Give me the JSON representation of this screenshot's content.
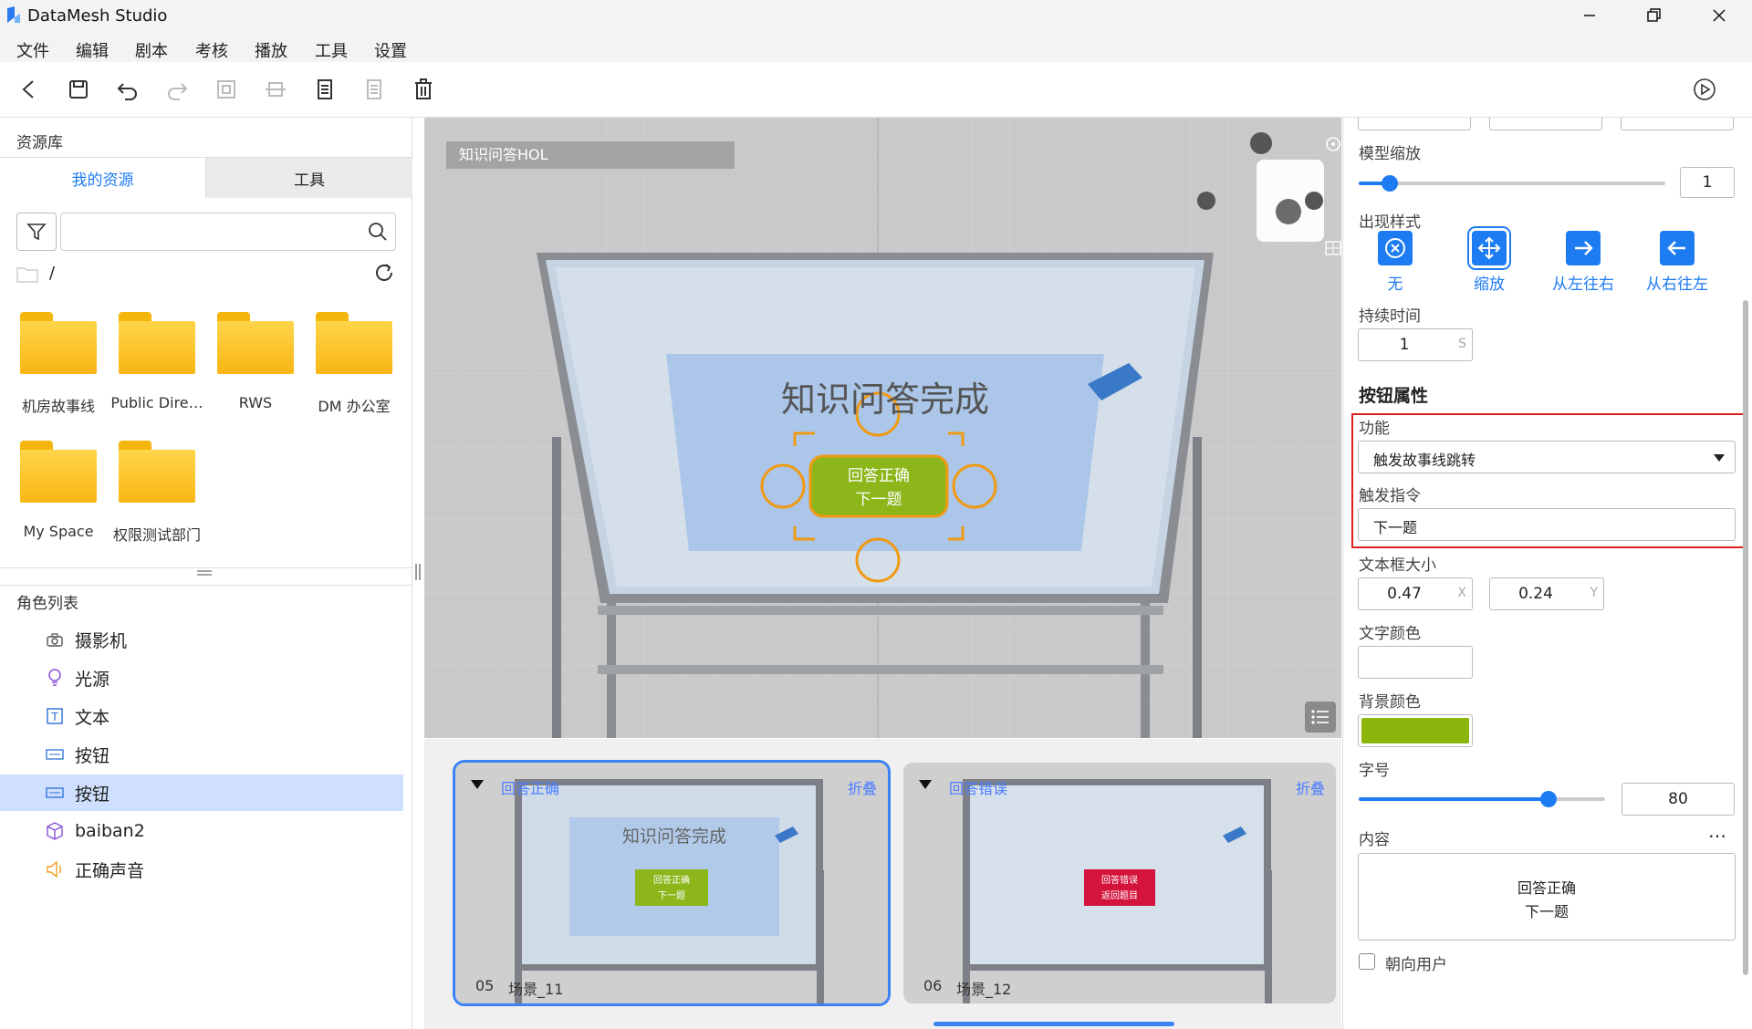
{
  "app": {
    "title": "DataMesh Studio"
  },
  "menu": [
    "文件",
    "编辑",
    "剧本",
    "考核",
    "播放",
    "工具",
    "设置"
  ],
  "left": {
    "library_title": "资源库",
    "tabs": [
      "我的资源",
      "工具"
    ],
    "path": "/",
    "folders": [
      "机房故事线",
      "Public Dire…",
      "RWS",
      "DM 办公室",
      "My Space",
      "权限测试部门"
    ],
    "roles_title": "角色列表",
    "roles": [
      {
        "label": "摄影机",
        "icon": "camera-icon"
      },
      {
        "label": "光源",
        "icon": "bulb-icon"
      },
      {
        "label": "文本",
        "icon": "text-icon"
      },
      {
        "label": "按钮",
        "icon": "button-icon"
      },
      {
        "label": "按钮",
        "icon": "button-icon"
      },
      {
        "label": "baiban2",
        "icon": "cube-icon"
      },
      {
        "label": "正确声音",
        "icon": "speaker-icon"
      }
    ]
  },
  "viewport": {
    "scene_label": "知识问答HOL",
    "board_title": "知识问答完成",
    "button_line1": "回答正确",
    "button_line2": "下一题"
  },
  "scenes": [
    {
      "caption": "回答正确",
      "fold": "折叠",
      "num": "05",
      "name": "场景_11",
      "title": "知识问答完成",
      "btn1": "回答正确",
      "btn2": "下一题",
      "btn_color": "#8cb61a"
    },
    {
      "caption": "回答错误",
      "fold": "折叠",
      "num": "06",
      "name": "场景_12",
      "btn1": "回答错误",
      "btn2": "返回题目",
      "btn_color": "#d4143c"
    }
  ],
  "props": {
    "model_scale_label": "模型缩放",
    "model_scale_value": "1",
    "model_scale_fraction": 0.1,
    "appear_style_label": "出现样式",
    "styles": [
      "无",
      "缩放",
      "从左往右",
      "从右往左"
    ],
    "selected_style": "缩放",
    "duration_label": "持续时间",
    "duration_value": "1",
    "duration_unit": "S",
    "button_props_title": "按钮属性",
    "function_label": "功能",
    "function_value": "触发故事线跳转",
    "trigger_label": "触发指令",
    "trigger_value": "下一题",
    "textbox_size_label": "文本框大小",
    "size_x": "0.47",
    "size_y": "0.24",
    "axis_x": "X",
    "axis_y": "Y",
    "text_color_label": "文字颜色",
    "text_color": "#ffffff",
    "bg_color_label": "背景颜色",
    "bg_color": "#8cb60c",
    "font_size_label": "字号",
    "font_size_value": "80",
    "font_size_fraction": 0.77,
    "content_label": "内容",
    "content_more": "…",
    "content_line1": "回答正确",
    "content_line2": "下一题",
    "face_user_label": "朝向用户",
    "face_user_checked": false
  },
  "colors": {
    "accent": "#1e7cf2",
    "highlight_box": "#e02020"
  }
}
